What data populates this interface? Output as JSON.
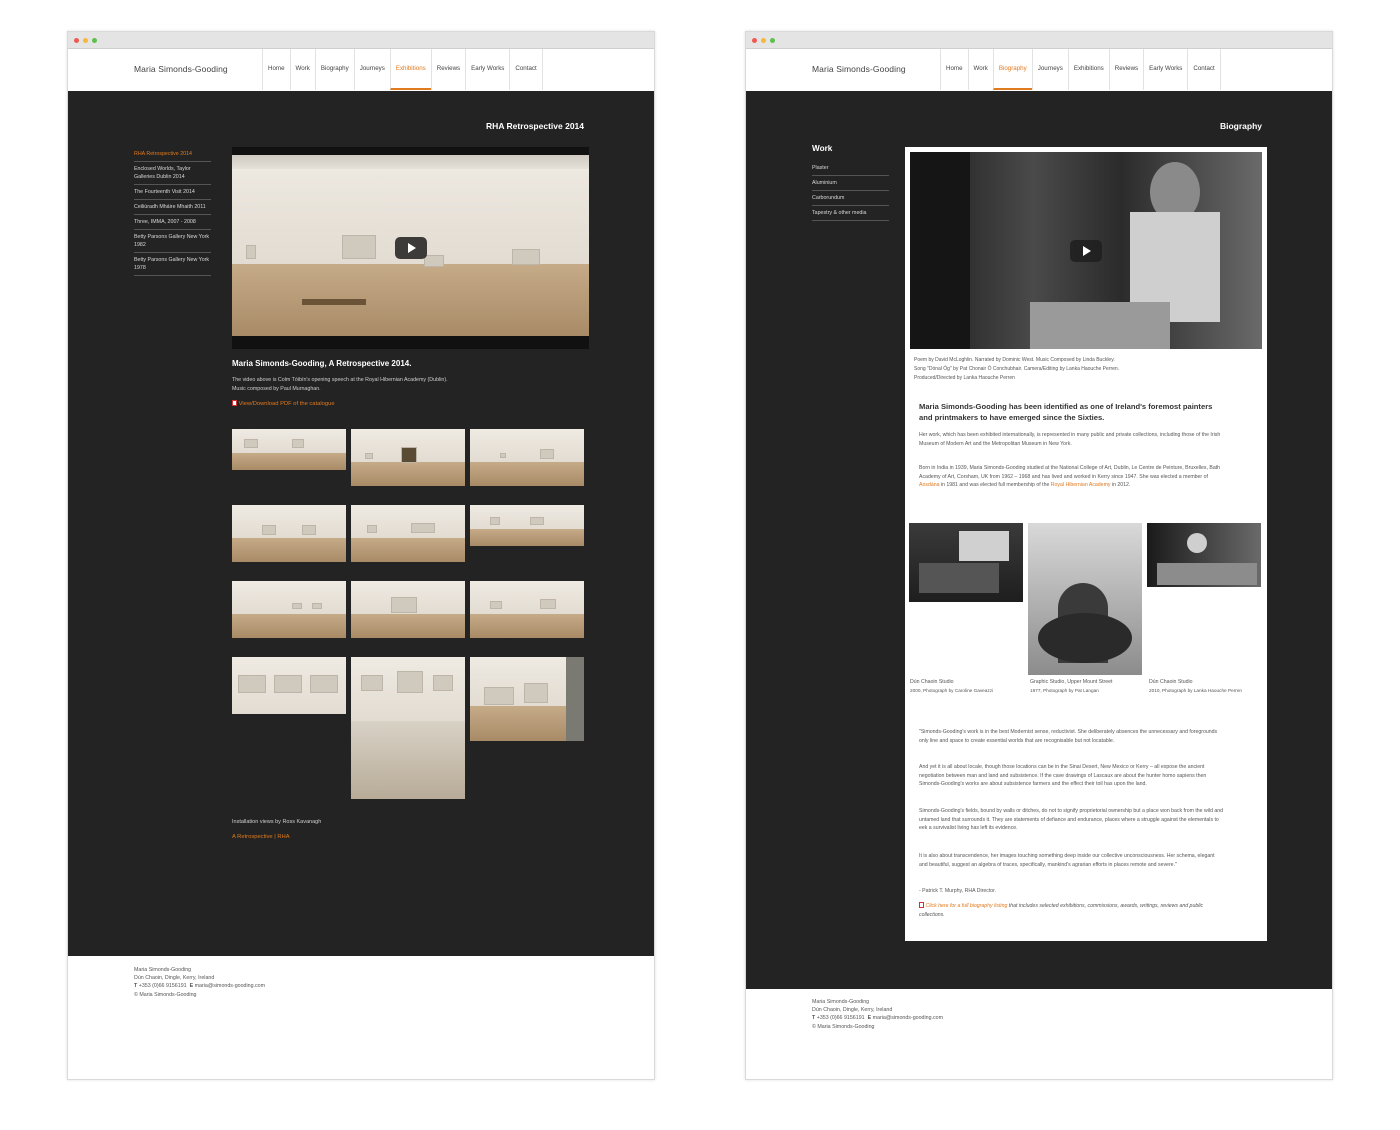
{
  "site": {
    "title": "Maria Simonds-Gooding",
    "nav": [
      "Home",
      "Work",
      "Biography",
      "Journeys",
      "Exhibitions",
      "Reviews",
      "Early Works",
      "Contact"
    ]
  },
  "left_page": {
    "heading": "RHA Retrospective 2014",
    "subnav": [
      "RHA Retrospective 2014",
      "Enclosed Worlds, Taylor Galleries Dublin 2014",
      "The Fourteenth Visit 2014",
      "Ceiliúradh Mháire Mhaith 2011",
      "Three, IMMA, 2007 - 2008",
      "Betty Parsons Gallery New York 1982",
      "Betty Parsons Gallery New York 1978"
    ],
    "video_title": "Maria Simonds-Gooding, A Retrospective 2014.",
    "video_desc_1": "The video above is Colm Tóibín's opening speech at the Royal Hibernian Academy (Dublin).",
    "video_desc_2": "Music composed by Paul Murnaghan.",
    "pdf_link": "View/Download PDF of the catalogue",
    "installation_credit": "Installation views by Ross Kavanagh",
    "rha_link": "A Retrospective | RHA"
  },
  "right_page": {
    "heading": "Biography",
    "subnav_title": "Work",
    "subnav": [
      "Plaster",
      "Aluminium",
      "Carborundum",
      "Tapestry & other media"
    ],
    "credits": [
      "Poem by David McLoghlin. Narrated by Dominic West. Music Composed by Linda Buckley.",
      "Song \"Dónal Óg\" by Pat Chonair Ó Conchubhair. Camera/Editing by Lanka Haouche Perren.",
      "Produced/Directed by Lanka Haouche Perren"
    ],
    "lead": "Maria Simonds-Gooding has been identified as one of Ireland's foremost painters and printmakers to have emerged since the Sixties.",
    "para1": "Her work, which has been exhibited internationally, is represented in many public and private collections, including those of the Irish Museum of Modern Art and the Metropolitan Museum in New York.",
    "para2_a": "Born in India in 1939, Maria Simonds-Gooding studied at the National College of Art, Dublin, Le Centre de Peinture, Bruxelles, Bath Academy of Art, Corsham, UK from 1962 – 1968 and has lived and worked in Kerry since 1947. She was elected a member of ",
    "aosdana": "Aosdána",
    "para2_b": " in 1981 and was elected full membership of the ",
    "rha": "Royal Hibernian Academy",
    "para2_c": " in 2012.",
    "photos": [
      {
        "title": "Dún Chaoin Studio",
        "sub": "2000, Photograph by Caroline Gaveazzi"
      },
      {
        "title": "Graphic Studio, Upper Mount Street",
        "sub": "1977, Photograph by Pat Langan"
      },
      {
        "title": "Dún Chaoin Studio",
        "sub": "2010, Photograph by Lanka Haouche Perren"
      }
    ],
    "quote1": "\"Simonds-Gooding's work is in the best Modernist sense, reductivist. She deliberately absences the unnecessary and foregrounds only line and space to create essential worlds that are recognisable but not locatable.",
    "quote2": "And yet it is all about locale, though those locations can be in the Sinai Desert, New Mexico or Kerry – all expose the ancient negotiation between man and land and subsistence. If the cave drawings of Lascaux are about the hunter homo sapiens then Simonds-Gooding's works are about subsistence farmers and the effect their toil has upon the land.",
    "quote3": "Simonds-Gooding's fields, bound by walls or ditches, do not to signify proprietorial ownership but a place won back from the wild and untamed land that surrounds it. They are statements of defiance and endurance, places where a struggle against the elementals to eek a survivalist living has left its evidence.",
    "quote4": "It is also about transcendence, her images touching something deep inside our collective unconsciousness. Her schema, elegant and beautiful, suggest an algebra of traces, specifically, mankind's agrarian efforts in places remote and severe.\"",
    "quote_author": "- Patrick T. Murphy, RHA Director.",
    "bio_link": "Click here for a full biography listing",
    "bio_link_rest": " that includes selected exhibitions, commissions, awards, writings, reviews and public collections."
  },
  "footer": {
    "name": "Maria Simonds-Gooding",
    "address": "Dún Chaoin, Dingle, Kerry, Ireland",
    "t_label": "T",
    "phone": "+353 (0)66 9156191",
    "e_label": "E",
    "email": "maria@simonds-gooding.com",
    "copyright": "© Maria Simonds-Gooding"
  },
  "colors": {
    "accent": "#e07a1f",
    "dark_bg": "#232323"
  }
}
